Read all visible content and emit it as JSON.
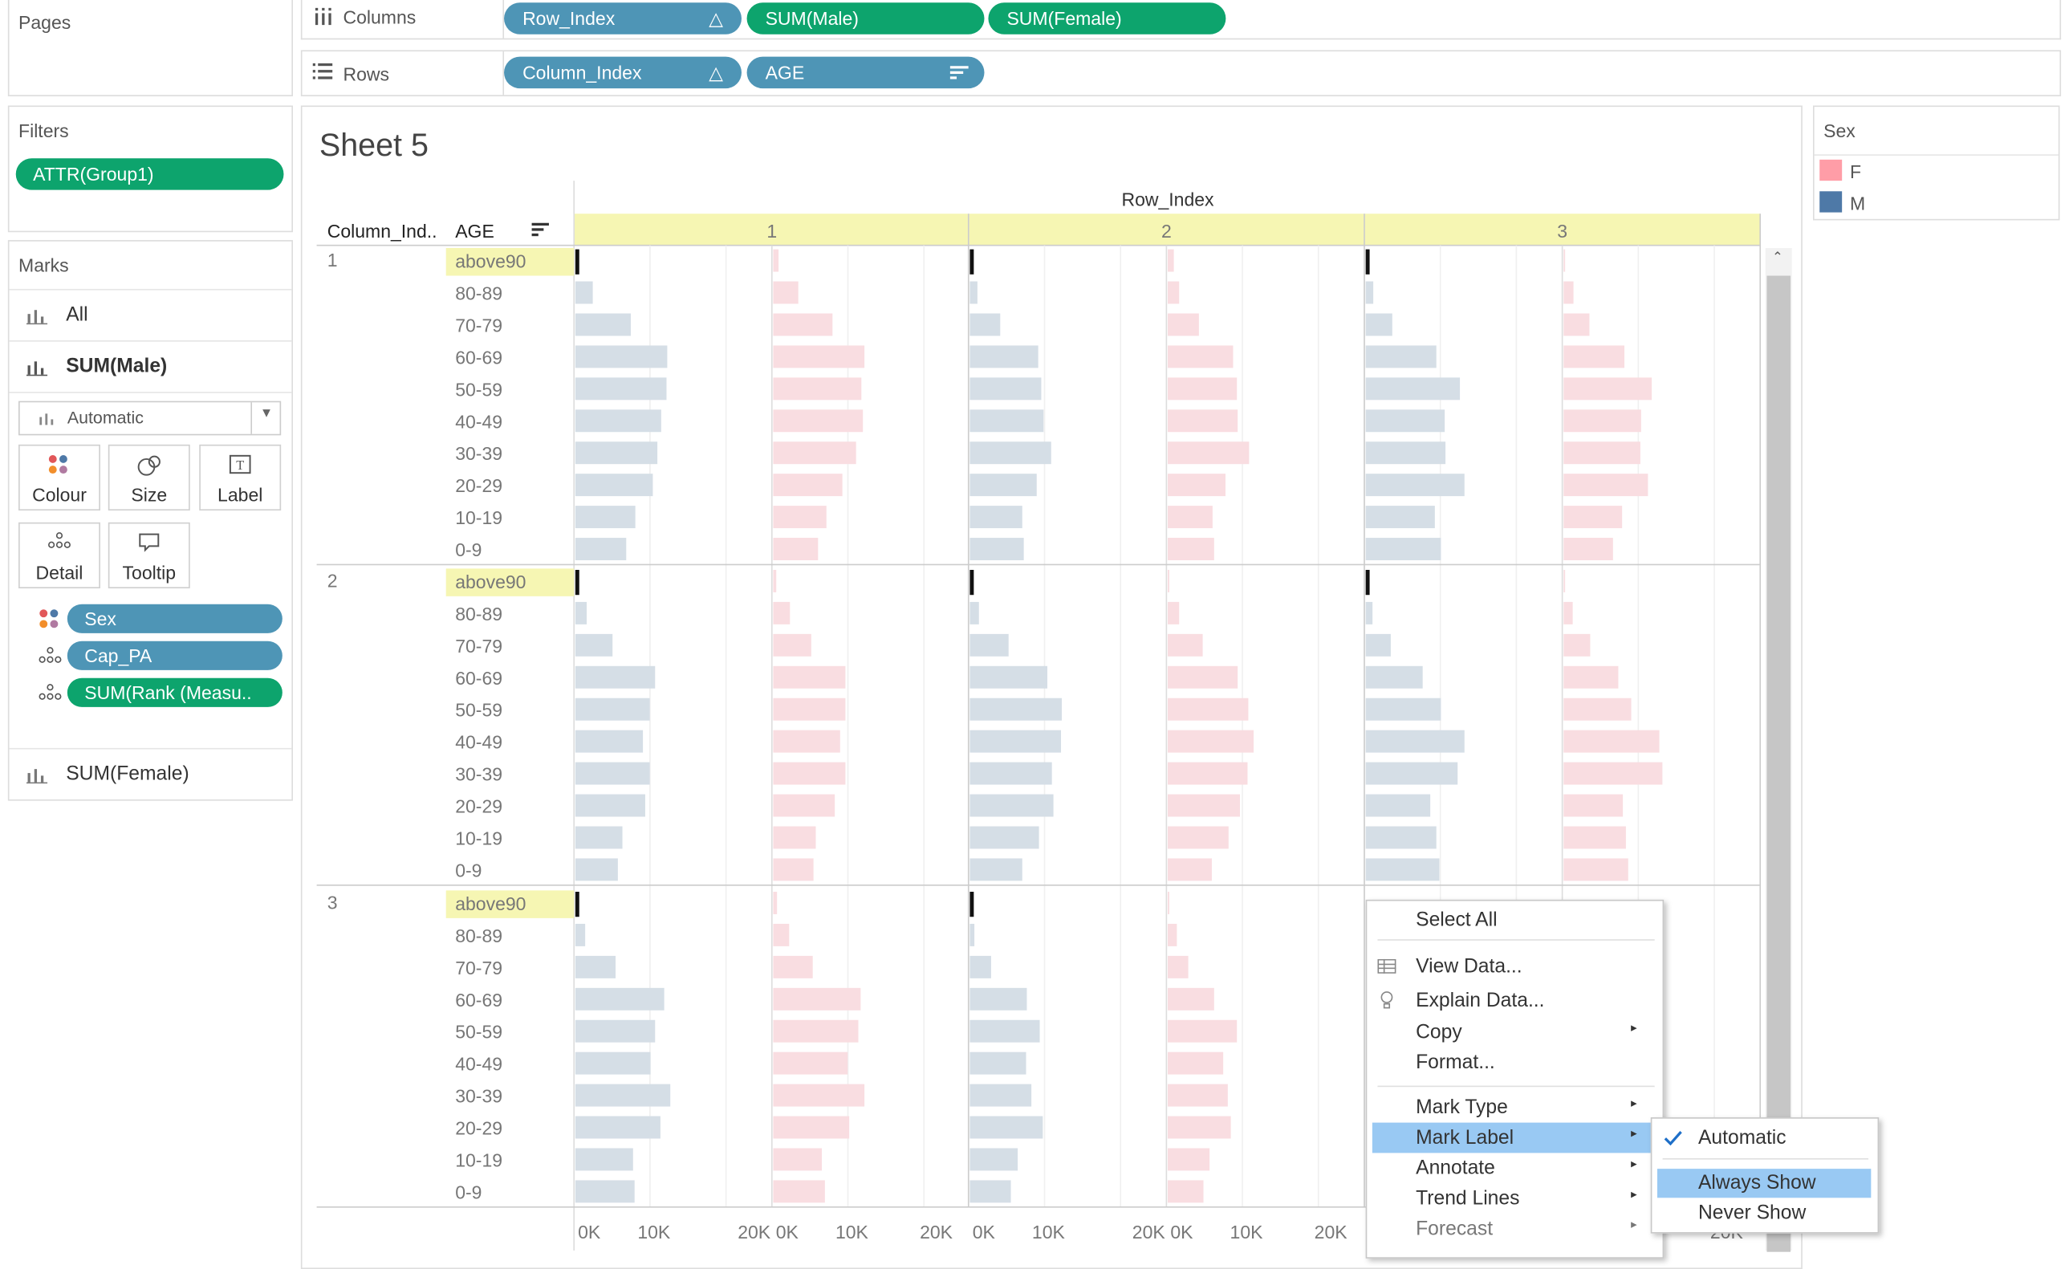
{
  "pages_title": "Pages",
  "filters": {
    "title": "Filters",
    "pill": "ATTR(Group1)"
  },
  "marks": {
    "title": "Marks",
    "all": "All",
    "sum_male": "SUM(Male)",
    "mark_type": "Automatic",
    "buttons": [
      "Colour",
      "Size",
      "Label",
      "Detail",
      "Tooltip"
    ],
    "fields": [
      "Sex",
      "Cap_PA",
      "SUM(Rank (Measu.."
    ],
    "sum_female": "SUM(Female)"
  },
  "columns_shelf": {
    "label": "Columns",
    "pills": [
      "Row_Index",
      "SUM(Male)",
      "SUM(Female)"
    ]
  },
  "rows_shelf": {
    "label": "Rows",
    "pills": [
      "Column_Index",
      "AGE"
    ]
  },
  "sheet_title": "Sheet 5",
  "legend": {
    "title": "Sex",
    "items": [
      {
        "label": "F",
        "color": "#ff9da7"
      },
      {
        "label": "M",
        "color": "#4e79a7"
      }
    ]
  },
  "colors": {
    "male_faded": "#d5dee6",
    "female_faded": "#f9dde1",
    "header_yellow": "#f6f6b3",
    "selection": "#99c9f3"
  },
  "context_menu": {
    "items": [
      "Select All",
      "View Data...",
      "Explain Data...",
      "Copy",
      "Format...",
      "Mark Type",
      "Mark Label",
      "Annotate",
      "Trend Lines",
      "Forecast"
    ],
    "submenu": [
      "Automatic",
      "Always Show",
      "Never Show"
    ]
  },
  "chart_data": {
    "type": "bar",
    "row_header": "Row_Index",
    "column_headers": [
      "Column_Ind..",
      "AGE"
    ],
    "columns": [
      "1",
      "2",
      "3"
    ],
    "rows": [
      "1",
      "2",
      "3"
    ],
    "categories": [
      "above90",
      "80-89",
      "70-79",
      "60-69",
      "50-59",
      "40-49",
      "30-39",
      "20-29",
      "10-19",
      "0-9"
    ],
    "axis_ticks": [
      "0K",
      "10K",
      "20K"
    ],
    "xlim": [
      0,
      25000
    ],
    "panels": [
      {
        "row": "1",
        "col": "1",
        "male": [
          200,
          2300,
          7300,
          12100,
          12000,
          11300,
          10800,
          10200,
          7900,
          6700
        ],
        "female": [
          700,
          3300,
          7800,
          12000,
          11600,
          11800,
          10900,
          9100,
          7000,
          5900
        ]
      },
      {
        "row": "1",
        "col": "2",
        "male": [
          200,
          1000,
          4000,
          9000,
          9400,
          9700,
          10700,
          8800,
          6900,
          7100
        ],
        "female": [
          800,
          1500,
          4100,
          8600,
          9100,
          9200,
          10700,
          7600,
          5900,
          6100
        ]
      },
      {
        "row": "1",
        "col": "3",
        "male": [
          200,
          1000,
          3500,
          9300,
          12400,
          10400,
          10500,
          13000,
          9100,
          9900
        ],
        "female": [
          200,
          1300,
          3400,
          8000,
          11600,
          10200,
          10100,
          11100,
          7700,
          6500
        ]
      },
      {
        "row": "2",
        "col": "1",
        "male": [
          200,
          1500,
          4900,
          10500,
          9800,
          8900,
          9800,
          9200,
          6200,
          5600
        ],
        "female": [
          400,
          2200,
          5000,
          9500,
          9500,
          8800,
          9500,
          8100,
          5600,
          5300
        ]
      },
      {
        "row": "2",
        "col": "2",
        "male": [
          200,
          1200,
          5100,
          10200,
          12100,
          12000,
          10800,
          11000,
          9100,
          6900
        ],
        "female": [
          200,
          1500,
          4600,
          9200,
          10600,
          11300,
          10500,
          9500,
          8000,
          5800
        ]
      },
      {
        "row": "2",
        "col": "3",
        "male": [
          200,
          900,
          3300,
          7500,
          9900,
          13000,
          12100,
          8500,
          9300,
          9700
        ],
        "female": [
          200,
          1200,
          3500,
          7200,
          8900,
          12600,
          13000,
          7800,
          8200,
          8500
        ]
      },
      {
        "row": "3",
        "col": "1",
        "male": [
          200,
          1300,
          5300,
          11700,
          10500,
          9900,
          12500,
          11200,
          7600,
          7800
        ],
        "female": [
          500,
          2100,
          5200,
          11500,
          11200,
          9800,
          12000,
          10000,
          6400,
          6800
        ]
      },
      {
        "row": "3",
        "col": "2",
        "male": [
          200,
          600,
          2800,
          7500,
          9200,
          7400,
          8100,
          9600,
          6300,
          5400
        ],
        "female": [
          200,
          1200,
          2700,
          6100,
          9100,
          7300,
          7900,
          8300,
          5500,
          4700
        ]
      },
      {
        "row": "3",
        "col": "3",
        "male": [
          0,
          0,
          0,
          0,
          0,
          0,
          0,
          0,
          0,
          0
        ],
        "female": [
          0,
          0,
          0,
          0,
          0,
          0,
          0,
          0,
          0,
          0
        ]
      }
    ]
  }
}
